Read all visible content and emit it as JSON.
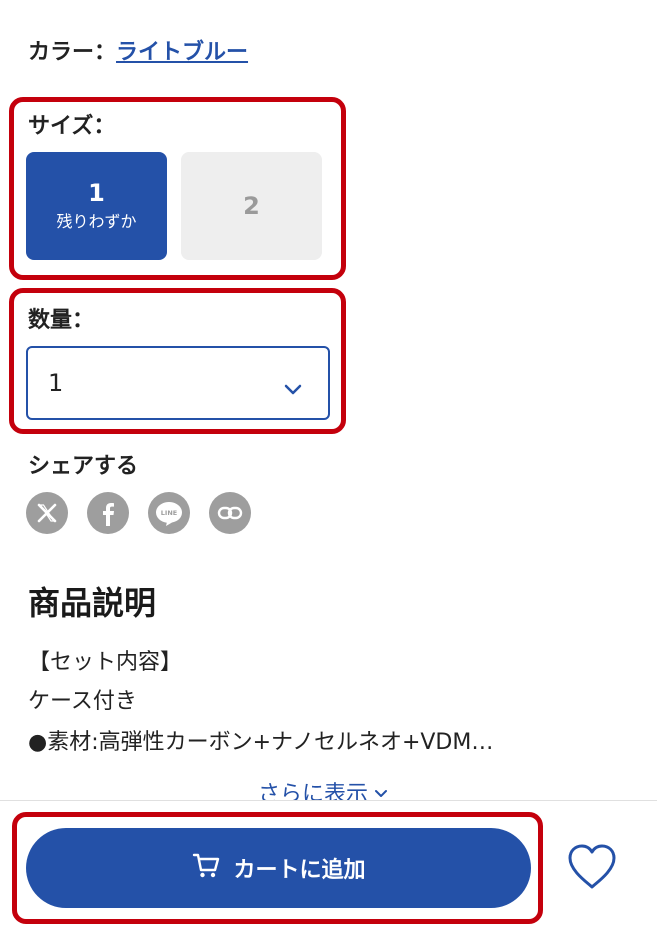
{
  "color": {
    "label": "カラー：",
    "value": "ライトブルー"
  },
  "size": {
    "label": "サイズ：",
    "options": [
      {
        "value": "1",
        "note": "残りわずか",
        "selected": true
      },
      {
        "value": "2",
        "note": "",
        "selected": false
      }
    ]
  },
  "quantity": {
    "label": "数量：",
    "value": "1"
  },
  "share": {
    "label": "シェアする",
    "icons": [
      "x-icon",
      "facebook-icon",
      "line-icon",
      "link-icon"
    ],
    "line_text": "LINE"
  },
  "description": {
    "title": "商品説明",
    "lines": [
      "【セット内容】",
      "ケース付き",
      "●素材:高弾性カーボン+ナノセルネオ+VDM…"
    ],
    "more_label": "さらに表示"
  },
  "actions": {
    "add_to_cart": "カートに追加",
    "favorite_icon": "heart-icon"
  },
  "colors": {
    "accent": "#2451a8",
    "highlight": "#c4000c",
    "icon_gray": "#9e9e9e"
  }
}
